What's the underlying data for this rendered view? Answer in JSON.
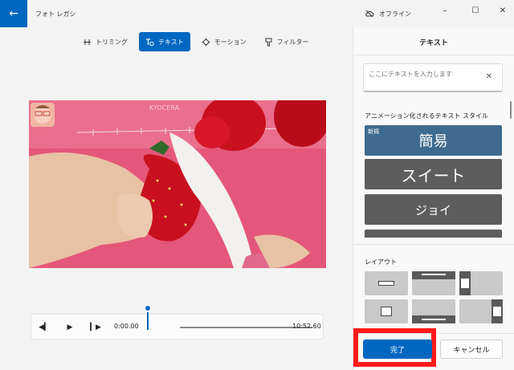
{
  "window": {
    "title": "フォト レガシ",
    "offline_label": "オフライン",
    "minimize": "–",
    "maximize": "☐",
    "close": "✕"
  },
  "toolbar": {
    "items": [
      {
        "label": "トリミング",
        "icon": "trim-icon",
        "active": false
      },
      {
        "label": "テキスト",
        "icon": "text-icon",
        "active": true
      },
      {
        "label": "モーション",
        "icon": "motion-icon",
        "active": false
      },
      {
        "label": "フィルター",
        "icon": "filter-icon",
        "active": false
      }
    ]
  },
  "video": {
    "watermark": "KYOCERA"
  },
  "player": {
    "current_time": "0:00.00",
    "duration": "10:52.60",
    "progress": 0
  },
  "panel": {
    "title": "テキスト",
    "input_placeholder": "ここにテキストを入力します",
    "clear_label": "✕",
    "animated_styles_label": "アニメーション化されるテキスト スタイル",
    "styles": [
      {
        "label": "簡易",
        "badge": "新規"
      },
      {
        "label": "スイート"
      },
      {
        "label": "ジョイ"
      }
    ],
    "layout_label": "レイアウト",
    "done_label": "完了",
    "cancel_label": "キャンセル"
  },
  "colors": {
    "accent": "#0067c0",
    "highlight": "#ff1a1a"
  }
}
